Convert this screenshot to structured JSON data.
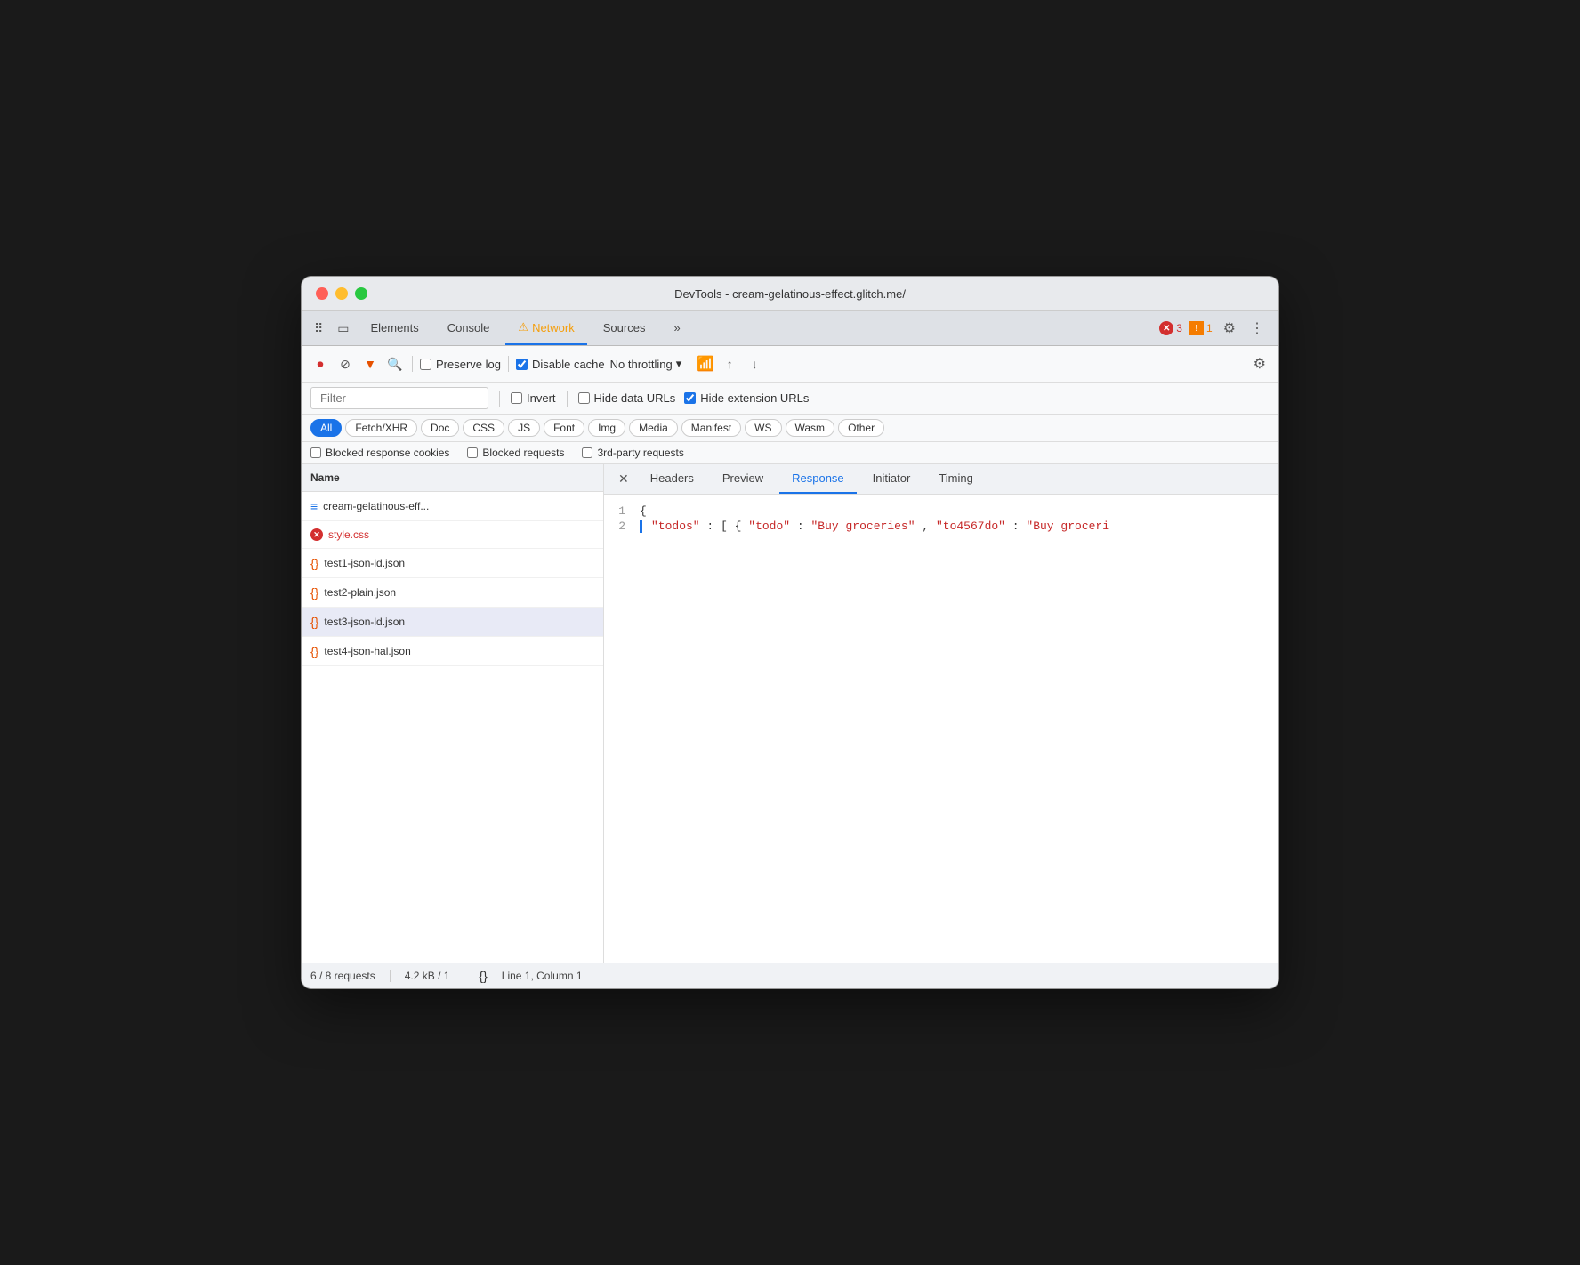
{
  "window": {
    "title": "DevTools - cream-gelatinous-effect.glitch.me/"
  },
  "tabs": {
    "items": [
      {
        "label": "Elements",
        "active": false,
        "warning": false
      },
      {
        "label": "Console",
        "active": false,
        "warning": false
      },
      {
        "label": "Network",
        "active": true,
        "warning": true
      },
      {
        "label": "Sources",
        "active": false,
        "warning": false
      },
      {
        "label": "»",
        "active": false,
        "warning": false
      }
    ],
    "error_count": "3",
    "warning_count": "1"
  },
  "toolbar": {
    "preserve_log": "Preserve log",
    "disable_cache": "Disable cache",
    "throttling": "No throttling"
  },
  "filter": {
    "placeholder": "Filter",
    "invert_label": "Invert",
    "hide_data_urls_label": "Hide data URLs",
    "hide_extension_urls_label": "Hide extension URLs"
  },
  "request_types": [
    {
      "label": "All",
      "active": true
    },
    {
      "label": "Fetch/XHR",
      "active": false
    },
    {
      "label": "Doc",
      "active": false
    },
    {
      "label": "CSS",
      "active": false
    },
    {
      "label": "JS",
      "active": false
    },
    {
      "label": "Font",
      "active": false
    },
    {
      "label": "Img",
      "active": false
    },
    {
      "label": "Media",
      "active": false
    },
    {
      "label": "Manifest",
      "active": false
    },
    {
      "label": "WS",
      "active": false
    },
    {
      "label": "Wasm",
      "active": false
    },
    {
      "label": "Other",
      "active": false
    }
  ],
  "extra_filters": [
    {
      "label": "Blocked response cookies",
      "checked": false
    },
    {
      "label": "Blocked requests",
      "checked": false
    },
    {
      "label": "3rd-party requests",
      "checked": false
    }
  ],
  "file_list": {
    "header": "Name",
    "items": [
      {
        "name": "cream-gelatinous-eff...",
        "icon": "doc",
        "selected": false
      },
      {
        "name": "style.css",
        "icon": "error",
        "selected": false
      },
      {
        "name": "test1-json-ld.json",
        "icon": "json",
        "selected": false
      },
      {
        "name": "test2-plain.json",
        "icon": "json",
        "selected": false
      },
      {
        "name": "test3-json-ld.json",
        "icon": "json",
        "selected": true
      },
      {
        "name": "test4-json-hal.json",
        "icon": "json",
        "selected": false
      }
    ]
  },
  "panel": {
    "tabs": [
      "Headers",
      "Preview",
      "Response",
      "Initiator",
      "Timing"
    ],
    "active_tab": "Response"
  },
  "code": {
    "lines": [
      {
        "num": "1",
        "content": "{",
        "has_bar": false
      },
      {
        "num": "2",
        "content": "\"todos\": [{\"todo\": \"Buy groceries\",\"to4567do\": \"Buy groceri",
        "has_bar": true
      }
    ]
  },
  "status_bar": {
    "requests": "6 / 8 requests",
    "size": "4.2 kB / 1",
    "position": "Line 1, Column 1"
  }
}
